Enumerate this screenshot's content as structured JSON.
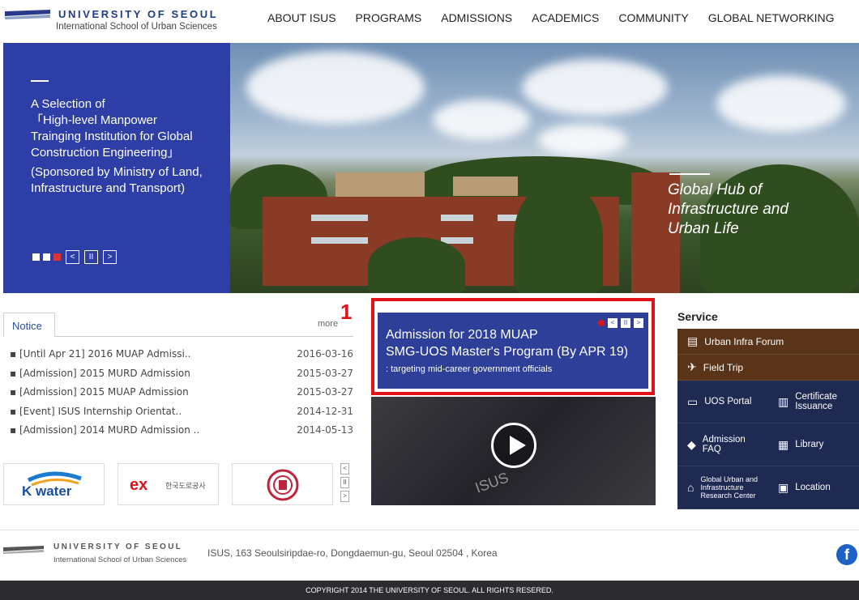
{
  "header": {
    "logo_title": "UNIVERSITY OF SEOUL",
    "logo_sub": "International School of Urban Sciences",
    "nav": [
      "ABOUT ISUS",
      "PROGRAMS",
      "ADMISSIONS",
      "ACADEMICS",
      "COMMUNITY",
      "GLOBAL NETWORKING"
    ]
  },
  "hero": {
    "lines": [
      "A Selection of",
      "「High-level Manpower",
      "Trainging Institution for Global",
      "Construction Engineering」",
      "(Sponsored by Ministry of Land,",
      "Infrastructure and Transport)"
    ],
    "right_lines": [
      "Global Hub of",
      "Infrastructure and",
      "Urban Life"
    ],
    "prev": "<",
    "pause": "II",
    "next": ">"
  },
  "notice": {
    "tab": "Notice",
    "more": "more",
    "items": [
      {
        "title": "[Until Apr 21] 2016 MUAP Admissi..",
        "date": "2016-03-16"
      },
      {
        "title": "[Admission] 2015 MURD Admission",
        "date": "2015-03-27"
      },
      {
        "title": "[Admission] 2015 MUAP Admission",
        "date": "2015-03-27"
      },
      {
        "title": "[Event] ISUS Internship Orientat..",
        "date": "2014-12-31"
      },
      {
        "title": "[Admission] 2014 MURD Admission ..",
        "date": "2014-05-13"
      }
    ]
  },
  "partners": {
    "kwater": "K water",
    "ex": "한국도로공사",
    "ctrl": [
      "<",
      "II",
      ">"
    ]
  },
  "callout": "1",
  "banner": {
    "title1": "Admission for 2018 MUAP",
    "title2": "SMG-UOS Master's Program (By APR 19)",
    "sub": ": targeting mid-career government officials",
    "ctrl": [
      "<",
      "II",
      ">"
    ]
  },
  "video": {
    "label": "ISUS"
  },
  "service": {
    "title": "Service",
    "wide": [
      {
        "label": "Urban Infra Forum",
        "icon": "forum-icon"
      },
      {
        "label": "Field Trip",
        "icon": "trip-icon"
      }
    ],
    "grid": [
      {
        "label": "UOS Portal",
        "icon": "portal-icon"
      },
      {
        "label": "Certificate Issuance",
        "icon": "certificate-icon"
      },
      {
        "label": "Admission FAQ",
        "icon": "faq-icon"
      },
      {
        "label": "Library",
        "icon": "library-icon"
      },
      {
        "label": "Global Urban and Infrastructure Research Center",
        "icon": "research-icon"
      },
      {
        "label": "Location",
        "icon": "location-icon"
      }
    ]
  },
  "footer": {
    "logo_title": "UNIVERSITY OF SEOUL",
    "logo_sub": "International School of Urban Sciences",
    "address": "ISUS, 163 Seoulsiripdae-ro, Dongdaemun-gu, Seoul 02504 , Korea",
    "facebook": "f",
    "copyright": "COPYRIGHT 2014 THE UNIVERSITY OF SEOUL. ALL RIGHTS RESERED."
  }
}
